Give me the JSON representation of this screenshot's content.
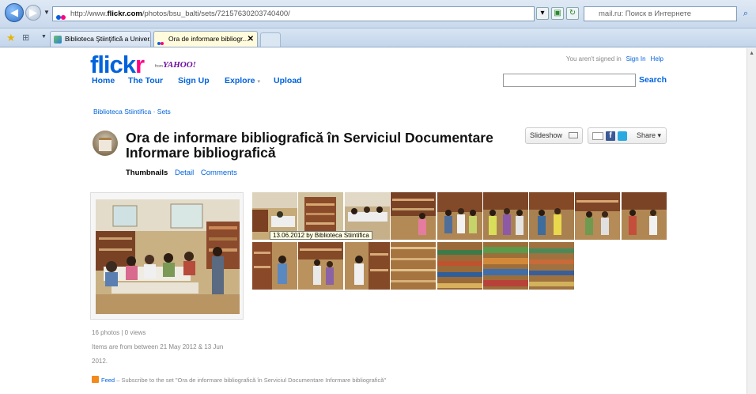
{
  "browser": {
    "url_prefix": "http://www.",
    "url_domain": "flickr.com",
    "url_path": "/photos/bsu_balti/sets/72157630203740400/",
    "search_text": "mail.ru: Поиск в Интернете",
    "tabs": [
      {
        "label": "Biblioteca Ştiinţifică a Univer...",
        "active": false
      },
      {
        "label": "Ora de informare bibliogr...",
        "active": true
      }
    ]
  },
  "site": {
    "logo_main_1": "flick",
    "logo_main_2": "r",
    "logo_from": "from",
    "logo_yahoo": "YAHOO!",
    "nav": [
      "Home",
      "The Tour",
      "Sign Up",
      "Explore",
      "Upload"
    ],
    "explore_dd": "▾",
    "signed_out_text": "You aren't signed in",
    "sign_in": "Sign In",
    "help": "Help",
    "search_button": "Search"
  },
  "set": {
    "breadcrumb": "Biblioteca Stiintifica · Sets",
    "title": "Ora de informare bibliografică în Serviciul Documentare Informare bibliografică",
    "subtabs": {
      "thumbnails": "Thumbnails",
      "detail": "Detail",
      "comments": "Comments"
    },
    "slideshow": "Slideshow",
    "share": "Share ▾",
    "tooltip": "13.06.2012 by Biblioteca Stiintifica",
    "stats": "16 photos | 0 views",
    "date_range_line1": "Items are from between 21 May 2012 & 13 Jun",
    "date_range_line2": "2012.",
    "feed_link": "Feed",
    "feed_text": "– Subscribe to the set \"Ora de informare bibliografică în Serviciul Documentare Informare bibliografică\""
  },
  "colors": {
    "flickr_blue": "#0063dc",
    "flickr_pink": "#ff0084"
  }
}
